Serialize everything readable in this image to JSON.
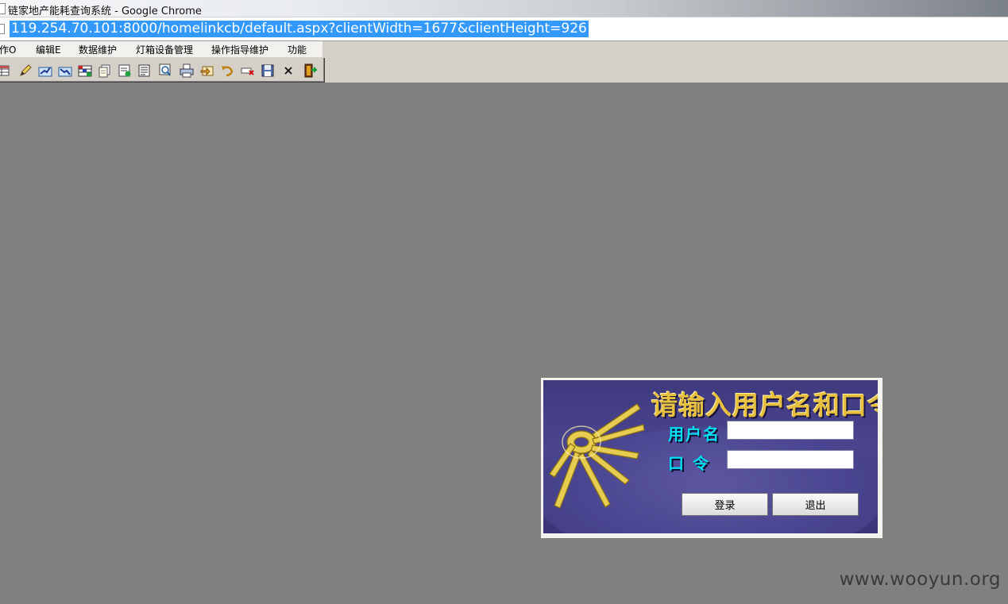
{
  "window": {
    "title": "链家地产能耗查询系统 - Google Chrome"
  },
  "address_bar": {
    "url": "119.254.70.101:8000/homelinkcb/default.aspx?clientWidth=1677&clientHeight=926"
  },
  "menu": {
    "items": [
      {
        "label": "操作O"
      },
      {
        "label": "编辑E"
      },
      {
        "label": "数据维护"
      },
      {
        "label": "灯箱设备管理"
      },
      {
        "label": "操作指导维护"
      },
      {
        "label": "功能"
      }
    ]
  },
  "toolbar": {
    "buttons": [
      {
        "icon": "grid-icon"
      },
      {
        "icon": "pencil-icon"
      },
      {
        "icon": "chart-up-icon"
      },
      {
        "icon": "chart-down-icon"
      },
      {
        "icon": "table-color-icon"
      },
      {
        "icon": "copy-icon"
      },
      {
        "icon": "export-icon"
      },
      {
        "icon": "document-icon"
      },
      {
        "icon": "preview-icon"
      },
      {
        "icon": "print-icon"
      },
      {
        "icon": "import-icon"
      },
      {
        "icon": "undo-icon"
      },
      {
        "icon": "delete-row-icon"
      },
      {
        "icon": "save-icon"
      },
      {
        "icon": "close-icon"
      },
      {
        "icon": "exit-door-icon"
      }
    ]
  },
  "login": {
    "heading": "请输入用户名和口令",
    "username_label": "用户名",
    "password_label": "口 令",
    "username_value": "",
    "password_value": "",
    "login_button": "登录",
    "exit_button": "退出"
  },
  "watermark": {
    "text": "www.wooyun.org"
  },
  "colors": {
    "desktop": "#808080",
    "panel": "#4b4590",
    "heading": "#e8c040",
    "label": "#00e0f0",
    "url_highlight": "#3399ff"
  }
}
